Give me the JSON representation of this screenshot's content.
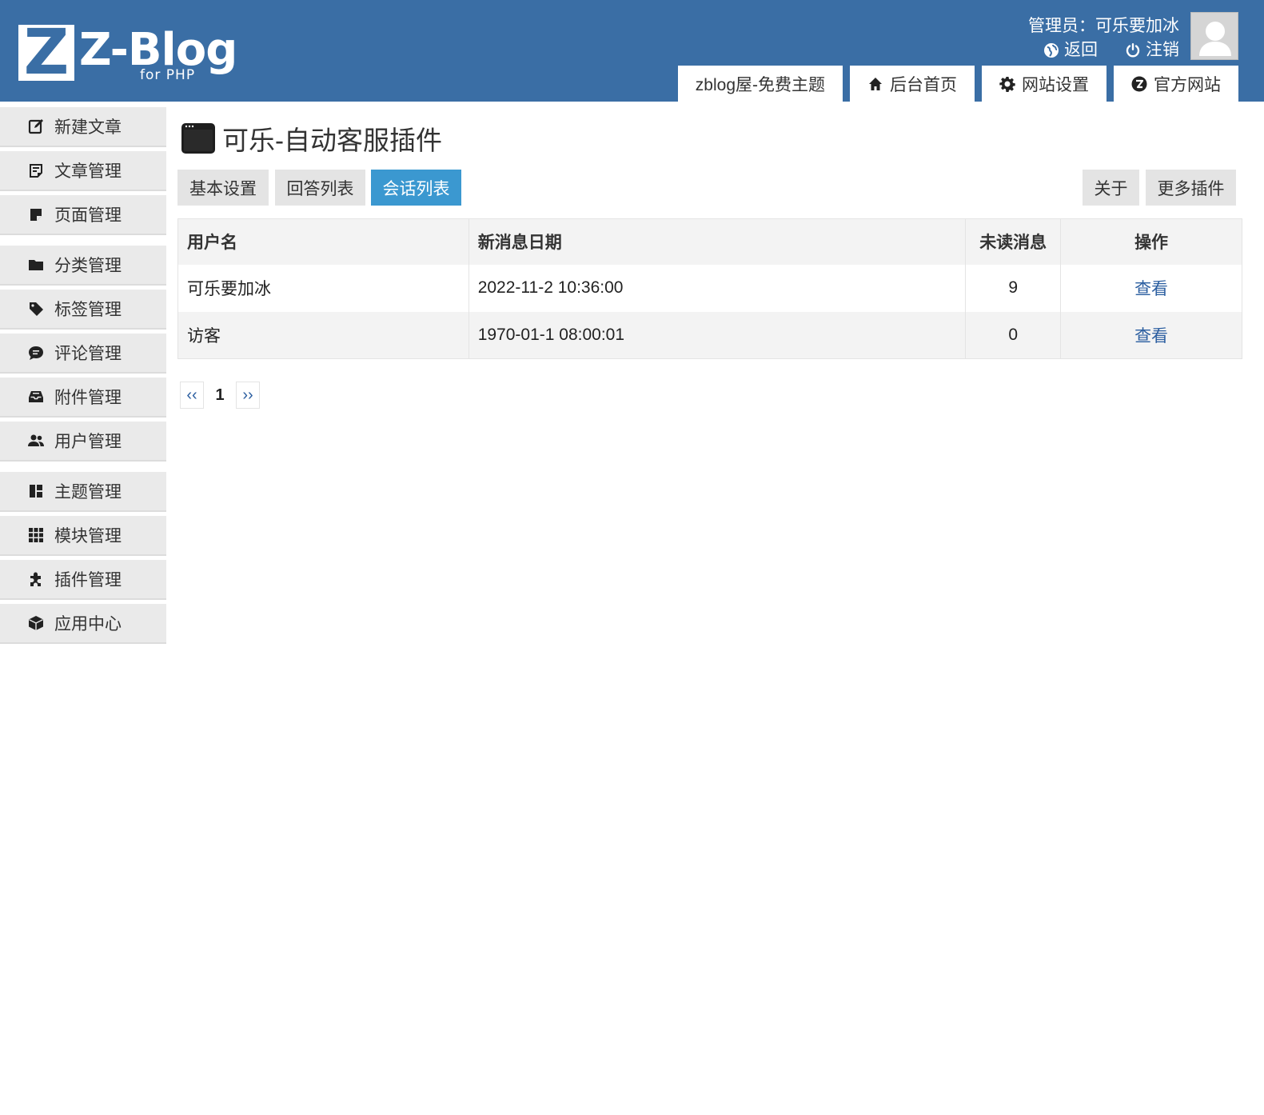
{
  "header": {
    "logo_mark": "Z",
    "logo_title": "Z-Blog",
    "logo_sub": "for PHP",
    "user_label": "管理员：可乐要加冰",
    "back_label": "返回",
    "logout_label": "注销",
    "tabs": [
      {
        "label": "zblog屋-免费主题",
        "icon": ""
      },
      {
        "label": "后台首页",
        "icon": "home-icon"
      },
      {
        "label": "网站设置",
        "icon": "gear-icon"
      },
      {
        "label": "官方网站",
        "icon": "zblog-icon"
      }
    ]
  },
  "sidebar": {
    "items": [
      {
        "label": "新建文章",
        "icon": "edit-icon"
      },
      {
        "label": "文章管理",
        "icon": "article-icon"
      },
      {
        "label": "页面管理",
        "icon": "page-icon"
      },
      {
        "label": "分类管理",
        "icon": "folder-icon"
      },
      {
        "label": "标签管理",
        "icon": "tag-icon"
      },
      {
        "label": "评论管理",
        "icon": "comment-icon"
      },
      {
        "label": "附件管理",
        "icon": "inbox-icon"
      },
      {
        "label": "用户管理",
        "icon": "users-icon"
      },
      {
        "label": "主题管理",
        "icon": "layout-icon"
      },
      {
        "label": "模块管理",
        "icon": "grid-icon"
      },
      {
        "label": "插件管理",
        "icon": "puzzle-icon"
      },
      {
        "label": "应用中心",
        "icon": "box-icon"
      }
    ]
  },
  "main": {
    "title": "可乐-自动客服插件",
    "tabs": [
      {
        "label": "基本设置",
        "active": false
      },
      {
        "label": "回答列表",
        "active": false
      },
      {
        "label": "会话列表",
        "active": true
      }
    ],
    "right_tabs": [
      {
        "label": "关于"
      },
      {
        "label": "更多插件"
      }
    ],
    "table": {
      "headers": [
        "用户名",
        "新消息日期",
        "未读消息",
        "操作"
      ],
      "rows": [
        {
          "user": "可乐要加冰",
          "date": "2022-11-2 10:36:00",
          "unread": "9",
          "action": "查看"
        },
        {
          "user": "访客",
          "date": "1970-01-1 08:00:01",
          "unread": "0",
          "action": "查看"
        }
      ]
    },
    "pager": {
      "prev": "‹‹",
      "current": "1",
      "next": "››"
    }
  },
  "colors": {
    "header_bg": "#3a6ea5",
    "active_tab": "#3b98d0",
    "link": "#2b5ea0"
  }
}
